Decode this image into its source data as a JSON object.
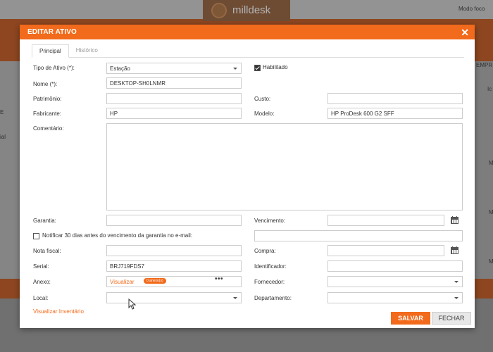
{
  "background": {
    "app_name": "milldesk",
    "modo_label": "Modo foco",
    "side_texts": [
      "E",
      "ial",
      "EMPR",
      "Ic",
      "M",
      "M",
      "M"
    ]
  },
  "modal": {
    "title": "EDITAR ATIVO",
    "close_icon": "close-icon",
    "tabs": [
      {
        "label": "Principal",
        "active": true
      },
      {
        "label": "Histórico",
        "active": false
      }
    ],
    "fields": {
      "tipo_label": "Tipo de Ativo (*):",
      "tipo_value": "Estação",
      "habilitado_label": "Habilitado",
      "nome_label": "Nome (*):",
      "nome_value": "DESKTOP-SH0LNMR",
      "patrimonio_label": "Patrimônio:",
      "patrimonio_value": "",
      "custo_label": "Custo:",
      "custo_value": "",
      "fabricante_label": "Fabricante:",
      "fabricante_value": "HP",
      "modelo_label": "Modelo:",
      "modelo_value": "HP ProDesk 600 G2 SFF",
      "comentario_label": "Comentário:",
      "garantia_label": "Garantia:",
      "garantia_value": "",
      "vencimento_label": "Vencimento:",
      "vencimento_value": "",
      "notificar_label": "Notificar 30 dias antes do vencimento da garantia no e-mail:",
      "notificar_email": "",
      "nota_label": "Nota fiscal:",
      "nota_value": "",
      "compra_label": "Compra:",
      "compra_value": "",
      "serial_label": "Serial:",
      "serial_value": "BRJ719FDS7",
      "identificador_label": "Identificador:",
      "identificador_value": "",
      "anexo_label": "Anexo:",
      "anexo_link": "Visualizar",
      "anexo_badge": "0 anexo(s)",
      "fornecedor_label": "Fornecedor:",
      "fornecedor_value": "",
      "local_label": "Local:",
      "local_value": "",
      "departamento_label": "Departamento:",
      "departamento_value": ""
    },
    "inventario_link": "Visualizar Inventário",
    "buttons": {
      "save": "SALVAR",
      "close": "FECHAR"
    }
  },
  "colors": {
    "accent": "#f26a1b"
  }
}
